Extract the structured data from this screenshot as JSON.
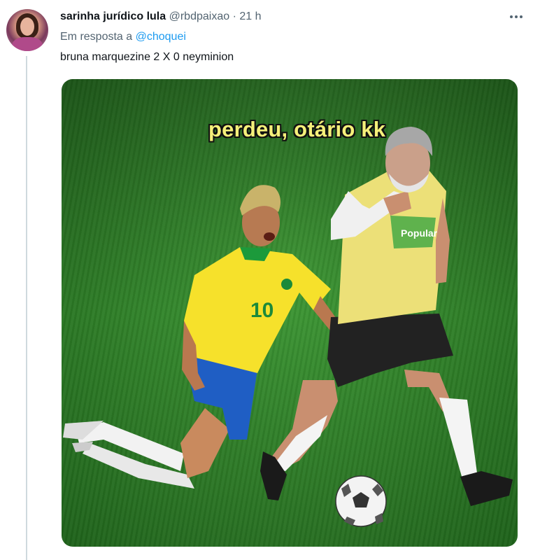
{
  "tweet": {
    "display_name": "sarinha jurídico lula",
    "handle": "@rbdpaixao",
    "separator": "·",
    "time": "21 h",
    "reply_prefix": "Em resposta a",
    "reply_to": "@choquei",
    "text": "bruna marquezine 2 X 0 neyminion"
  },
  "media": {
    "caption": "perdeu, otário kk",
    "jersey_number": "10",
    "shirt_logo_text": "Popular"
  },
  "colors": {
    "link": "#1d9bf0",
    "muted": "#536471",
    "pitch": "#2f7f28",
    "caption": "#f5f07a"
  }
}
